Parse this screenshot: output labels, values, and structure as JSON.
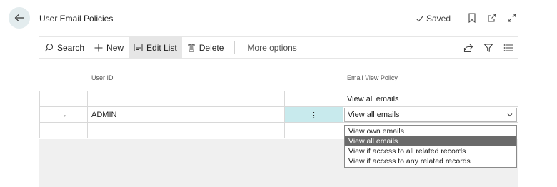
{
  "header": {
    "title": "User Email Policies",
    "saved_label": "Saved"
  },
  "actions": {
    "search": "Search",
    "new": "New",
    "edit_list": "Edit List",
    "delete": "Delete",
    "more_options": "More options"
  },
  "grid": {
    "columns": [
      "User ID",
      "Email View Policy"
    ],
    "rows": [
      {
        "user_id": "",
        "policy": "View all emails"
      },
      {
        "user_id": "ADMIN",
        "policy": "View all emails"
      },
      {
        "user_id": "",
        "policy": ""
      }
    ],
    "row_menu_glyph": "⋮",
    "current_row_glyph": "→"
  },
  "dropdown": {
    "options": [
      "View own emails",
      "View all emails",
      "View if access to all related records",
      "View if access to any related records"
    ],
    "selected": "View all emails"
  },
  "colors": {
    "accent_selected_cell": "#c8eaed",
    "back_button_bg": "#e3ecee",
    "selected_option_bg": "#6a6a6a"
  }
}
